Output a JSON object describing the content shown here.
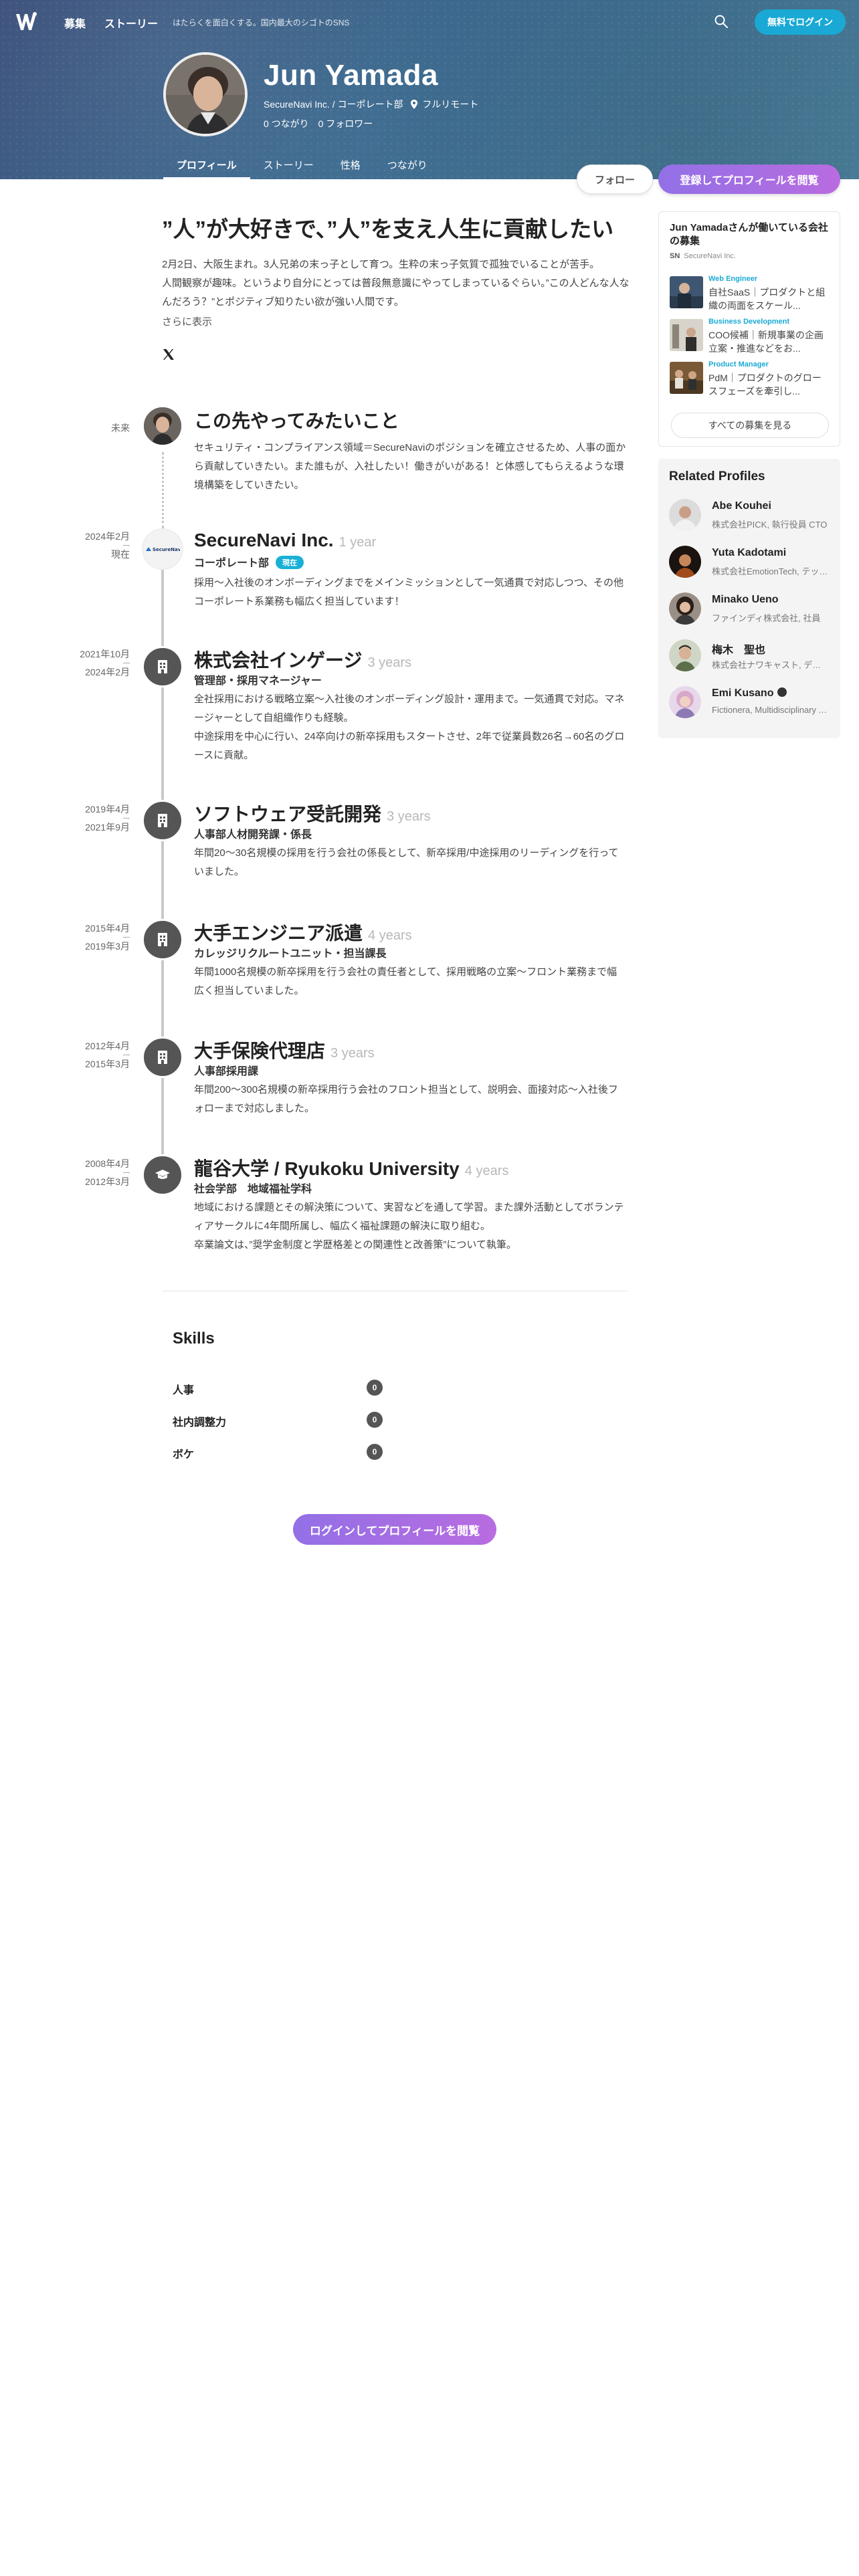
{
  "nav": {
    "items": [
      "募集",
      "ストーリー"
    ],
    "tagline": "はたらくを面白くする。国内最大のシゴトのSNS",
    "login": "無料でログイン"
  },
  "profile": {
    "name": "Jun Yamada",
    "company": "SecureNavi Inc. / コーポレート部",
    "location": "フルリモート",
    "connections": "0 つながり",
    "followers": "0 フォロワー",
    "tabs": [
      "プロフィール",
      "ストーリー",
      "性格",
      "つながり"
    ],
    "follow": "フォロー",
    "view_profile": "登録してプロフィールを閲覧"
  },
  "about": {
    "headline": "”人”が大好きで、”人”を支え人生に貢献したい",
    "bio": "2月2日、大阪生まれ。3人兄弟の末っ子として育つ。生粋の末っ子気質で孤独でいることが苦手。\n人間観察が趣味。というより自分にとっては普段無意識にやってしまっているぐらい。”この人どんな人なんだろう？”とポジティブ知りたい欲が強い人間です。",
    "more": "さらに表示"
  },
  "timeline": [
    {
      "date_top": "未来",
      "title": "この先やってみたいこと",
      "years": "",
      "role": "",
      "badge": "",
      "desc": "セキュリティ・コンプライアンス領域＝SecureNaviのポジションを確立させるため、人事の面から貢献していきたい。また誰もが、入社したい！働きがいがある！と体感してもらえるような環境構築をしていきたい。"
    },
    {
      "date_top": "2024年2月",
      "date_bottom": "現在",
      "title": "SecureNavi Inc.",
      "years": "1 year",
      "role": "コーポレート部",
      "badge": "現在",
      "logo": "SecureNavi",
      "desc": "採用〜入社後のオンボーディングまでをメインミッションとして一気通貫で対応しつつ、その他コーポレート系業務も幅広く担当しています！"
    },
    {
      "date_top": "2021年10月",
      "date_bottom": "2024年2月",
      "title": "株式会社インゲージ",
      "years": "3 years",
      "role": "管理部・採用マネージャー",
      "desc": "全社採用における戦略立案〜入社後のオンボーディング設計・運用まで。一気通貫で対応。マネージャーとして自組織作りも経験。\n中途採用を中心に行い、24卒向けの新卒採用もスタートさせ、2年で従業員数26名→60名のグロースに貢献。"
    },
    {
      "date_top": "2019年4月",
      "date_bottom": "2021年9月",
      "title": "ソフトウェア受託開発",
      "years": "3 years",
      "role": "人事部人材開発課・係長",
      "desc": "年間20〜30名規模の採用を行う会社の係長として、新卒採用/中途採用のリーディングを行っていました。"
    },
    {
      "date_top": "2015年4月",
      "date_bottom": "2019年3月",
      "title": "大手エンジニア派遣",
      "years": "4 years",
      "role": "カレッジリクルートユニット・担当課長",
      "desc": "年間1000名規模の新卒採用を行う会社の責任者として、採用戦略の立案〜フロント業務まで幅広く担当していました。"
    },
    {
      "date_top": "2012年4月",
      "date_bottom": "2015年3月",
      "title": "大手保険代理店",
      "years": "3 years",
      "role": "人事部採用課",
      "desc": "年間200〜300名規模の新卒採用行う会社のフロント担当として、説明会、面接対応〜入社後フォローまで対応しました。"
    },
    {
      "date_top": "2008年4月",
      "date_bottom": "2012年3月",
      "title": "龍谷大学 / Ryukoku University",
      "years": "4 years",
      "role": "社会学部　地域福祉学科",
      "desc": "地域における課題とその解決策について、実習などを通して学習。また課外活動としてボランティアサークルに4年間所属し、幅広く福祉課題の解決に取り組む。\n卒業論文は、”奨学金制度と学歴格差との関連性と改善策”について執筆。"
    }
  ],
  "skills": {
    "title": "Skills",
    "items": [
      {
        "name": "人事",
        "count": "0"
      },
      {
        "name": "社内調整力",
        "count": "0"
      },
      {
        "name": "ボケ",
        "count": "0"
      }
    ],
    "cta": "ログインしてプロフィールを閲覧"
  },
  "sidebar": {
    "jobs_title": "Jun Yamadaさんが働いている会社の募集",
    "company_mark": "SN",
    "company_name": "SecureNavi Inc.",
    "jobs": [
      {
        "category": "Web Engineer",
        "text": "自社SaaS｜プロダクトと組織の両面をスケール..."
      },
      {
        "category": "Business Development",
        "text": "COO候補｜新規事業の企画立案・推進などをお..."
      },
      {
        "category": "Product Manager",
        "text": "PdM｜プロダクトのグロースフェーズを牽引し..."
      }
    ],
    "all_jobs": "すべての募集を見る",
    "related_title": "Related Profiles",
    "people": [
      {
        "name": "Abe Kouhei",
        "sub": "株式会社PICK, 執行役員 CTO"
      },
      {
        "name": "Yuta Kadotami",
        "sub": "株式会社EmotionTech, テックリード"
      },
      {
        "name": "Minako Ueno",
        "sub": "ファインディ株式会社, 社員"
      },
      {
        "name": "梅木　聖也",
        "sub": "株式会社ナワキャスト, デザイナー"
      },
      {
        "name": "Emi Kusano",
        "sub": "Fictionera, Multidisciplinary Artist"
      }
    ]
  },
  "colors": {
    "accent": "#19a9d4",
    "cta_gradient_start": "#9370e6",
    "cta_gradient_end": "#b86ce0",
    "hero": "#3d6a8f"
  }
}
